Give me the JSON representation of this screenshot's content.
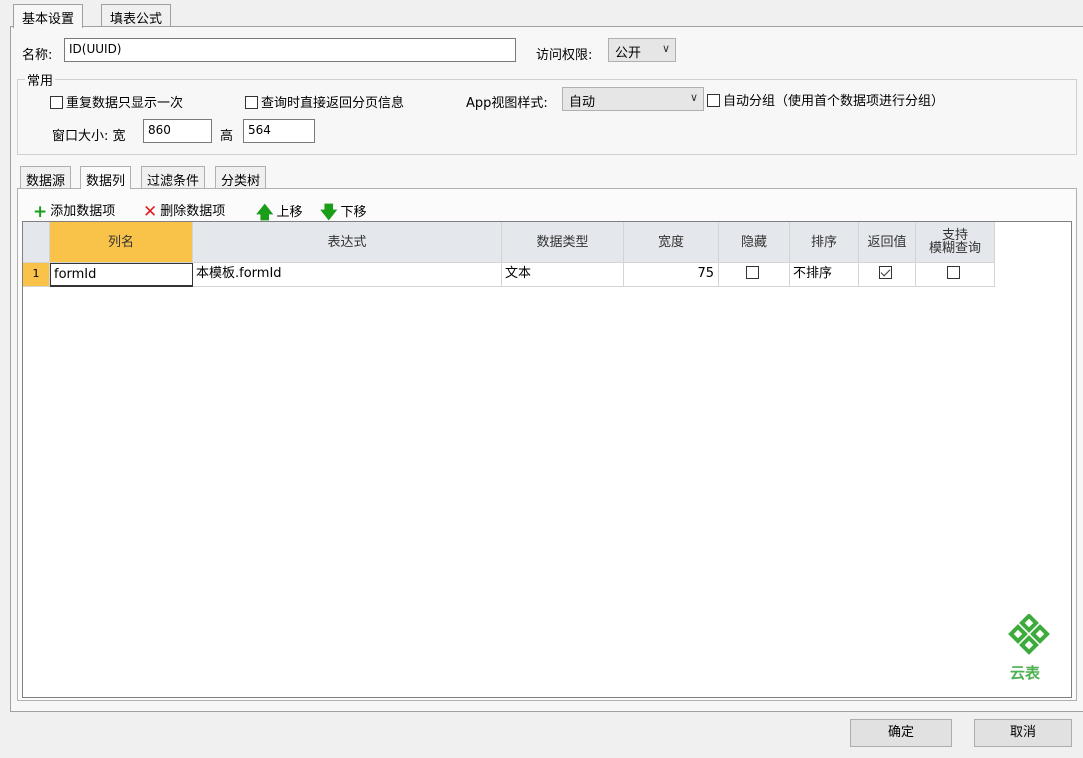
{
  "tabs": {
    "basic": "基本设置",
    "formula": "填表公式"
  },
  "form": {
    "name_label": "名称:",
    "name_value": "ID(UUID)",
    "access_label": "访问权限:",
    "access_value": "公开"
  },
  "common": {
    "title": "常用",
    "repeat_once": "重复数据只显示一次",
    "return_page_info": "查询时直接返回分页信息",
    "app_view_label": "App视图样式:",
    "app_view_value": "自动",
    "auto_group": "自动分组（使用首个数据项进行分组）",
    "window_size_label": "窗口大小: 宽",
    "width_value": "860",
    "height_label": "高",
    "height_value": "564"
  },
  "subtabs": [
    "数据源",
    "数据列",
    "过滤条件",
    "分类树"
  ],
  "toolbar": {
    "add": "添加数据项",
    "delete": "删除数据项",
    "up": "上移",
    "down": "下移"
  },
  "grid": {
    "headers": {
      "col_name": "列名",
      "expression": "表达式",
      "data_type": "数据类型",
      "width": "宽度",
      "hidden": "隐藏",
      "sort": "排序",
      "return_value": "返回值",
      "fuzzy_1": "支持",
      "fuzzy_2": "模糊查询"
    },
    "rows": [
      {
        "index": "1",
        "col_name": "formId",
        "expression": "本模板.formId",
        "data_type": "文本",
        "width": "75",
        "hidden": false,
        "sort": "不排序",
        "return_value": true,
        "fuzzy": false
      }
    ]
  },
  "logo": {
    "text": "云表"
  },
  "buttons": {
    "ok": "确定",
    "cancel": "取消"
  },
  "colors": {
    "accent": "#f8c348",
    "green": "#1a9e1a",
    "red": "#e02020"
  }
}
